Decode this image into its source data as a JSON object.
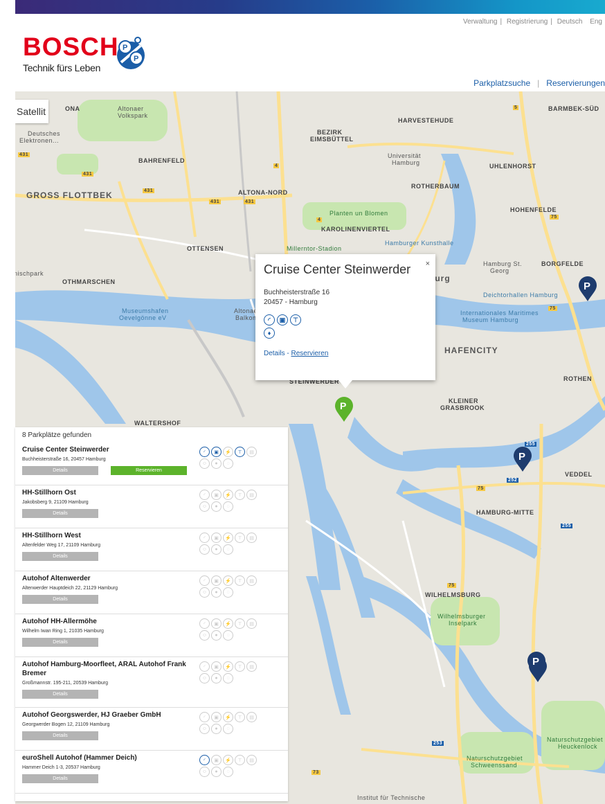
{
  "top_links": [
    "Verwaltung",
    "Registrierung",
    "Deutsch",
    "Eng"
  ],
  "brand": {
    "name": "BOSCH",
    "tagline": "Technik fürs Leben",
    "color": "#e2001a"
  },
  "sub_nav": [
    "Parkplatzsuche",
    "Reservierungen"
  ],
  "map": {
    "satellite_label": "Satellit",
    "labels": {
      "harvestehude": "HARVESTEHUDE",
      "barmbek": "BARMBEK-SÜD",
      "bezirk": "BEZIRK",
      "eimsbuettel": "EIMSBÜTTEL",
      "bahrenfeld": "BAHRENFELD",
      "uni1": "Universität",
      "uni2": "Hamburg",
      "uhlenhorst": "UHLENHORST",
      "rotherbaum": "ROTHERBAUM",
      "gross_flottbek": "GROSS FLOTTBEK",
      "altona_nord": "ALTONA-NORD",
      "hohenfelde": "HOHENFELDE",
      "planten": "Planten un Blomen",
      "karolinen": "KAROLINENVIERTEL",
      "ottensen": "OTTENSEN",
      "millerntor": "Millerntor-Stadion",
      "kunsthalle": "Hamburger Kunsthalle",
      "othmarschen": "OTHMARSCHEN",
      "hbf1": "Hamburg St.",
      "hbf2": "Georg",
      "borgfelde": "BORGFELDE",
      "deichtor": "Deichtorhallen Hamburg",
      "museumshafen1": "Museumshafen",
      "museumshafen2": "Oevelgönne eV",
      "altonaer1": "Altonaer",
      "altonaer2": "Balkon",
      "maritim1": "Internationales Maritimes",
      "maritim2": "Museum Hamburg",
      "hafencity": "HAFENCITY",
      "rothen": "ROTHEN",
      "steinwerder": "STEINWERDER",
      "kleiner1": "KLEINER",
      "kleiner2": "GRASBROOK",
      "waltershof": "WALTERSHOF",
      "veddel": "VEDDEL",
      "hamburg_mitte": "HAMBURG-MITTE",
      "wilhelmsburg": "WILHELMSBURG",
      "inselpark1": "Wilhelmsburger",
      "inselpark2": "Inselpark",
      "nsg1a": "Naturschutzgebiet",
      "nsg1b": "Heuckenlock",
      "nsg2a": "Naturschutzgebiet",
      "nsg2b": "Schweenssand",
      "institut": "Institut für Technische",
      "burg": "burg",
      "nischpark": "nischpark",
      "altonaer_vp1": "Altonaer",
      "altonaer_vp2": "Volkspark",
      "deutsches1": "Deutsches",
      "deutsches2": "Elektronen...",
      "ona": "ONA",
      "r431a": "431",
      "r431b": "431",
      "r431c": "431",
      "r431d": "431",
      "r431e": "431",
      "r4a": "4",
      "r4b": "4",
      "r5": "5",
      "r75a": "75",
      "r75b": "75",
      "r75c": "75",
      "r75d": "75",
      "r255a": "255",
      "r255b": "255",
      "r252": "252",
      "r253": "253",
      "r73": "73"
    },
    "popup": {
      "title": "Cruise Center Steinwerder",
      "close": "×",
      "street": "Buchheisterstraße 16",
      "city": "20457 - Hamburg",
      "details": "Details",
      "separator": " - ",
      "reserve": "Reservieren"
    }
  },
  "results": {
    "count_label": "8 Parkplätze gefunden",
    "details_label": "Details",
    "reserve_label": "Reservieren",
    "items": [
      {
        "name": "Cruise Center Steinwerder",
        "address": "Buchheisterstraße 16, 20457 Hamburg"
      },
      {
        "name": "HH-Stillhorn Ost",
        "address": "Jakobsberg 9, 21109 Hamburg"
      },
      {
        "name": "HH-Stillhorn West",
        "address": "Altenfelder Weg 17, 21109 Hamburg"
      },
      {
        "name": "Autohof Altenwerder",
        "address": "Altenwerder Hauptdeich 22, 21129 Hamburg"
      },
      {
        "name": "Autohof HH-Allermöhe",
        "address": "Wilhelm Iwan Ring 1, 21035 Hamburg"
      },
      {
        "name": "Autohof Hamburg-Moorfleet, ARAL Autohof Frank Bremer",
        "address": "Großmannstr. 195-211, 20539 Hamburg"
      },
      {
        "name": "Autohof Georgswerder, HJ Graeber GmbH",
        "address": "Georgwerder Bogen 12, 21109 Hamburg"
      },
      {
        "name": "euroShell Autohof (Hammer Deich)",
        "address": "Hammer Deich 1-3, 20537 Hamburg"
      }
    ]
  },
  "colors": {
    "accent_blue": "#1b5ea8",
    "reserve_green": "#5cb32b",
    "details_gray": "#b4b4b4"
  }
}
